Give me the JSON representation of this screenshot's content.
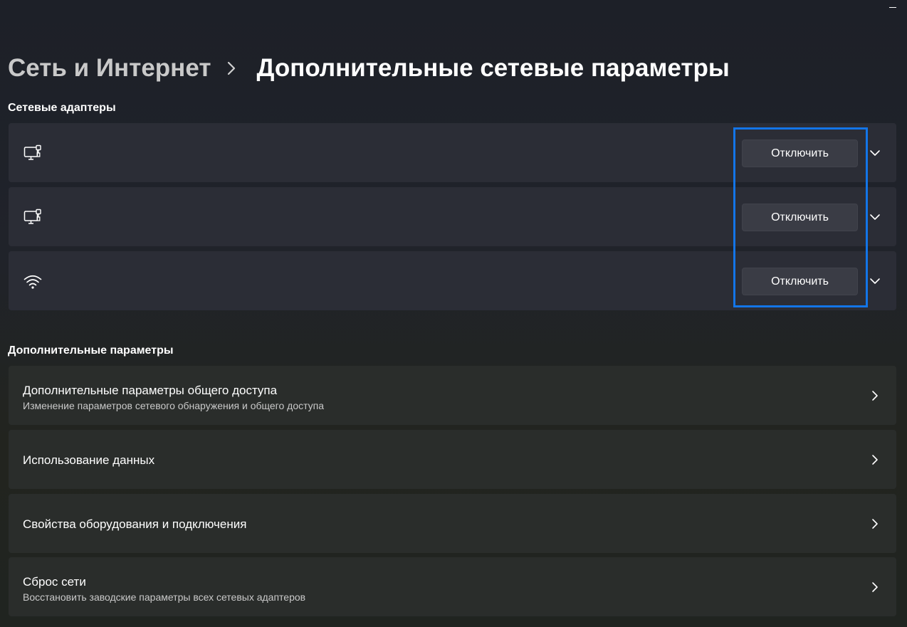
{
  "window": {
    "minimize_icon": "minimize-icon"
  },
  "breadcrumb": {
    "parent": "Сеть и Интернет",
    "separator_icon": "chevron-right-icon",
    "current": "Дополнительные сетевые параметры"
  },
  "adapters_section": {
    "title": "Сетевые адаптеры",
    "items": [
      {
        "icon": "ethernet-monitor-icon",
        "button_label": "Отключить",
        "expand_icon": "chevron-down-icon"
      },
      {
        "icon": "ethernet-monitor-icon",
        "button_label": "Отключить",
        "expand_icon": "chevron-down-icon"
      },
      {
        "icon": "wifi-icon",
        "button_label": "Отключить",
        "expand_icon": "chevron-down-icon"
      }
    ]
  },
  "more_section": {
    "title": "Дополнительные параметры",
    "items": [
      {
        "title": "Дополнительные параметры общего доступа",
        "subtitle": "Изменение параметров сетевого обнаружения и общего доступа"
      },
      {
        "title": "Использование данных",
        "subtitle": ""
      },
      {
        "title": "Свойства оборудования и подключения",
        "subtitle": ""
      },
      {
        "title": "Сброс сети",
        "subtitle": "Восстановить заводские параметры всех сетевых адаптеров"
      }
    ]
  },
  "colors": {
    "highlight": "#1375e8",
    "card": "#2b2d36",
    "button": "#3a3c45"
  }
}
